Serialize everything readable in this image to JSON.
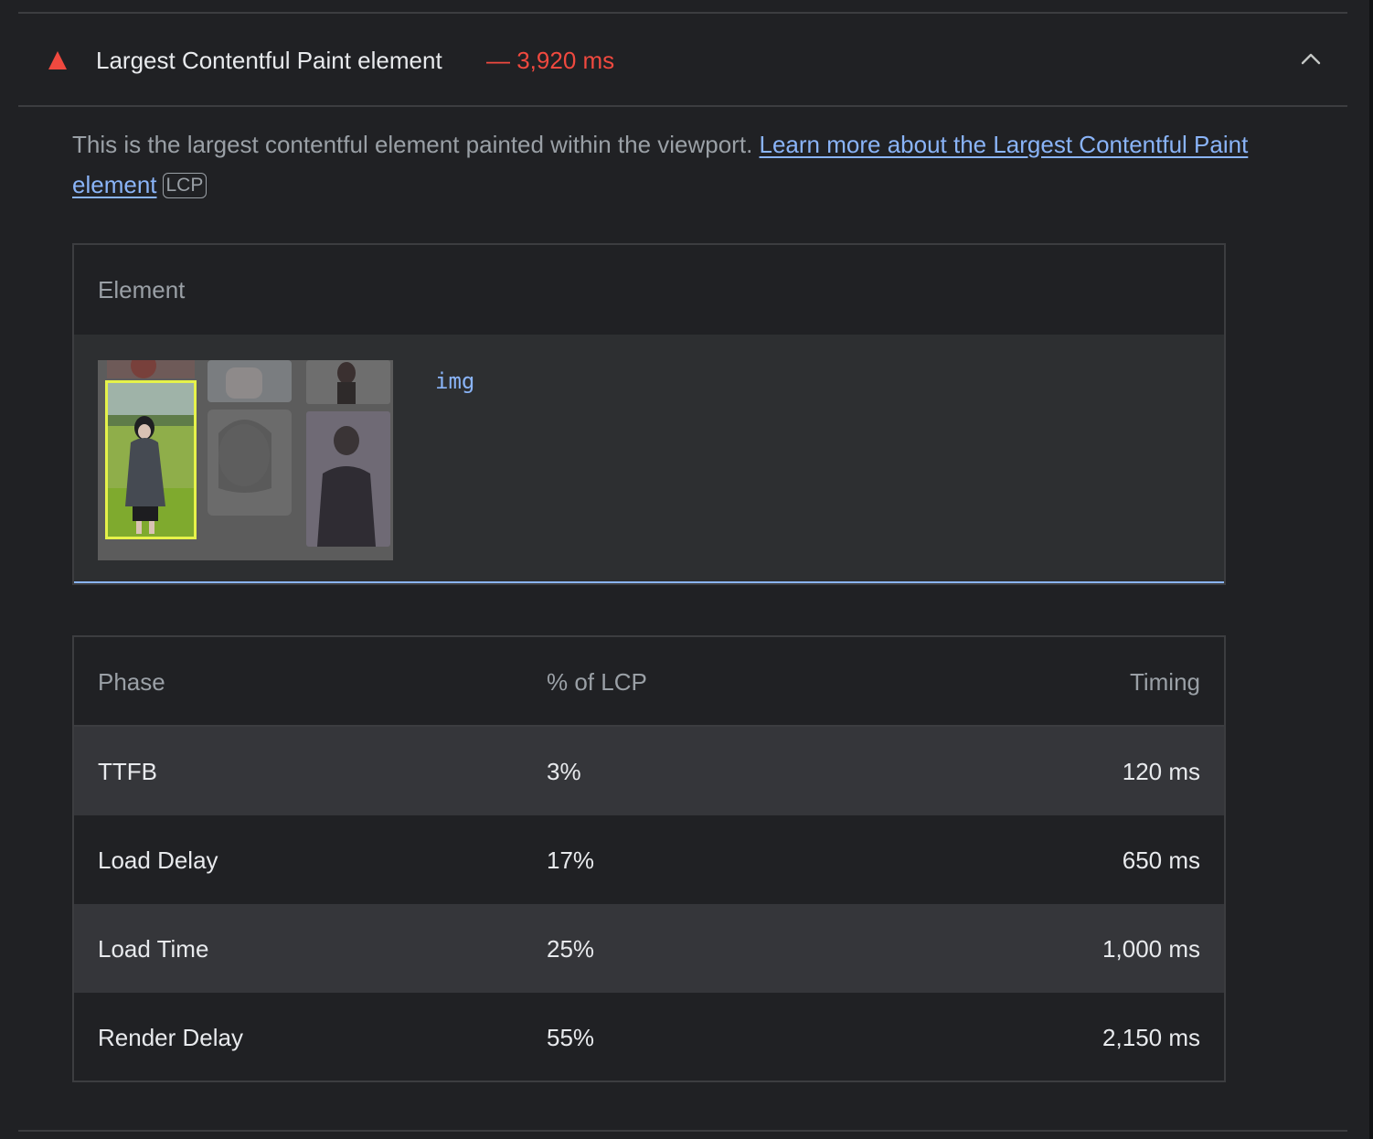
{
  "audit": {
    "title": "Largest Contentful Paint element",
    "value": "— 3,920 ms",
    "description_text": "This is the largest contentful element painted within the viewport. ",
    "learn_more_link": "Learn more about the Largest Contentful Paint element",
    "badge": "LCP",
    "colors": {
      "fail": "#f0493f",
      "link": "#8ab4f8",
      "background": "#202124"
    },
    "icons": {
      "status": "fail-triangle-icon",
      "toggle": "chevron-up-icon"
    }
  },
  "element_table": {
    "header": "Element",
    "node_label": "img"
  },
  "phase_table": {
    "headers": {
      "phase": "Phase",
      "percent": "% of LCP",
      "timing": "Timing"
    },
    "rows": [
      {
        "phase": "TTFB",
        "percent": "3%",
        "timing": "120 ms"
      },
      {
        "phase": "Load Delay",
        "percent": "17%",
        "timing": "650 ms"
      },
      {
        "phase": "Load Time",
        "percent": "25%",
        "timing": "1,000 ms"
      },
      {
        "phase": "Render Delay",
        "percent": "55%",
        "timing": "2,150 ms"
      }
    ]
  }
}
